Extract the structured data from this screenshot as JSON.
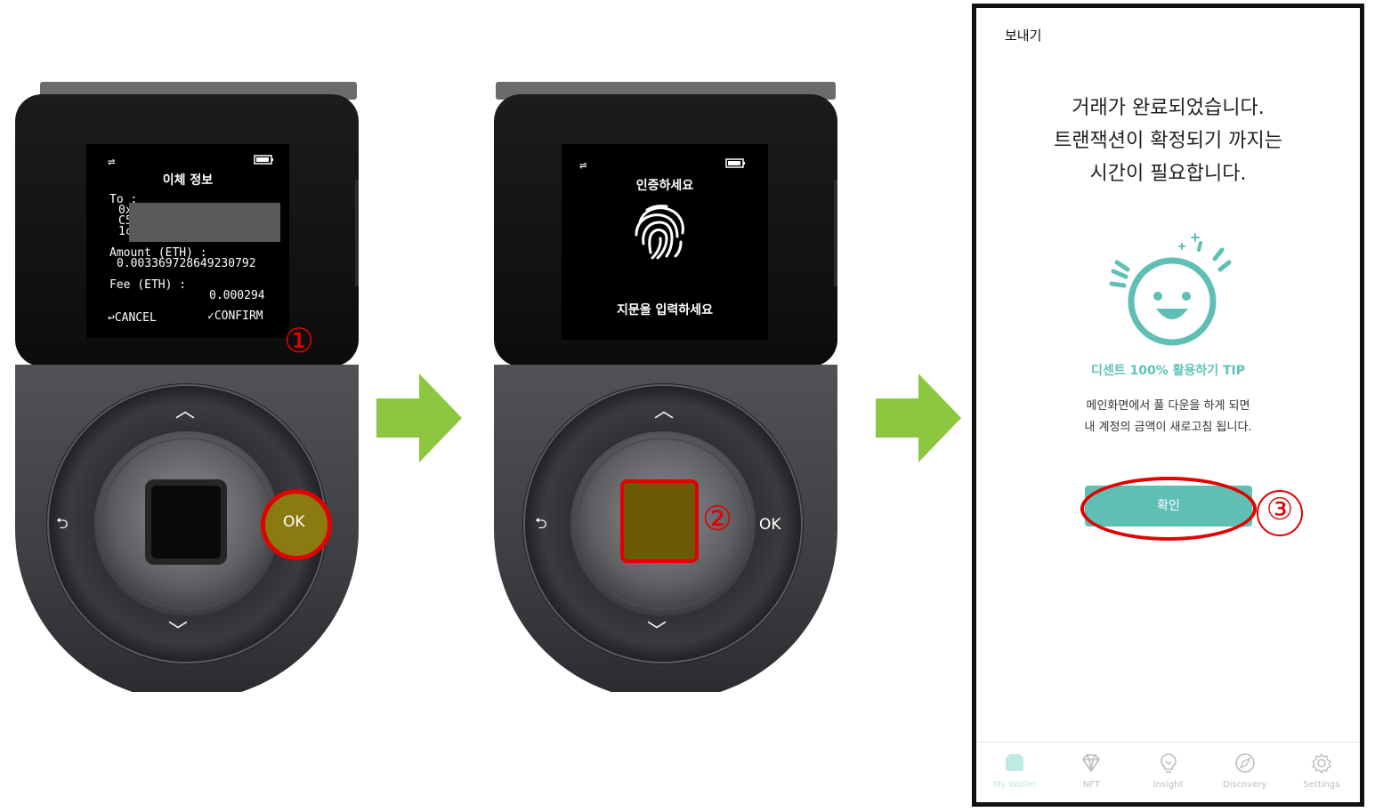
{
  "device1": {
    "screen": {
      "left_icon": "transfer-arrows-icon",
      "battery_icon": "battery-icon",
      "title": "이체 정보",
      "to_label": "To :",
      "to_prefix_lines": [
        "0x",
        "C5",
        "1c"
      ],
      "amount_label": "Amount (ETH) :",
      "amount_value": "0.003369728649230792",
      "fee_label": "Fee (ETH) :",
      "fee_value": "0.000294",
      "cancel_label": "↩CANCEL",
      "confirm_label": "✓CONFIRM"
    },
    "ok_label": "OK",
    "step": "①"
  },
  "device2": {
    "screen": {
      "left_icon": "transfer-arrows-icon",
      "battery_icon": "battery-icon",
      "title": "인증하세요",
      "fingerprint_icon": "fingerprint-icon",
      "prompt": "지문을 입력하세요"
    },
    "ok_label": "OK",
    "step": "②"
  },
  "phone": {
    "header": "보내기",
    "message_lines": [
      "거래가 완료되었습니다.",
      "트랜잭션이 확정되기 까지는",
      "시간이 필요합니다."
    ],
    "tip_title": "디센트 100% 활용하기 TIP",
    "tip_lines": [
      "메인화면에서 풀 다운을 하게 되면",
      "내 계정의 금액이 새로고침 됩니다."
    ],
    "confirm_button": "확인",
    "step": "③",
    "nav": [
      {
        "label": "My Wallet",
        "icon": "wallet-icon",
        "active": true
      },
      {
        "label": "NFT",
        "icon": "diamond-icon",
        "active": false
      },
      {
        "label": "Insight",
        "icon": "lightbulb-icon",
        "active": false
      },
      {
        "label": "Discovery",
        "icon": "compass-icon",
        "active": false
      },
      {
        "label": "Settings",
        "icon": "gear-icon",
        "active": false
      }
    ]
  },
  "colors": {
    "accent_teal": "#5fbfb4",
    "highlight_red": "#e30000",
    "arrow_green": "#8dc63f",
    "ok_highlight": "#8a7a10"
  }
}
